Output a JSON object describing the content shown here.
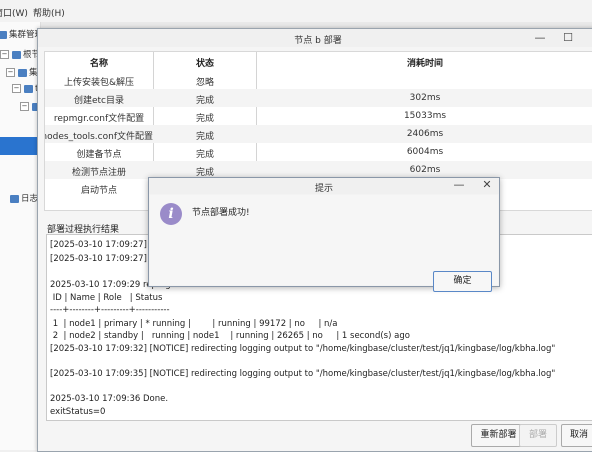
{
  "menubar": {
    "window_menu": "窗口(W)",
    "help_menu": "帮助(H)"
  },
  "tree": {
    "title": "集群管理",
    "items": [
      "根节点",
      "集群",
      "t",
      "",
      "日志"
    ]
  },
  "deploy_dialog": {
    "title": "节点 b 部署",
    "minimize": "—",
    "maximize": "☐",
    "columns": [
      "名称",
      "状态",
      "消耗时间"
    ],
    "rows": [
      {
        "name": "上传安装包&解压",
        "status": "忽略",
        "time": ""
      },
      {
        "name": "创建etc目录",
        "status": "完成",
        "time": "302ms"
      },
      {
        "name": "repmgr.conf文件配置",
        "status": "完成",
        "time": "15033ms"
      },
      {
        "name": "all_nodes_tools.conf文件配置",
        "status": "完成",
        "time": "2406ms"
      },
      {
        "name": "创建备节点",
        "status": "完成",
        "time": "6004ms"
      },
      {
        "name": "检测节点注册",
        "status": "完成",
        "time": "602ms"
      },
      {
        "name": "启动节点",
        "status": "",
        "time": ""
      }
    ],
    "log_label": "部署过程执行结果",
    "log_lines": [
      "[2025-03-10 17:09:27] [INFO]",
      "[2025-03-10 17:09:27] [NOTICE]",
      "",
      "2025-03-10 17:09:29 repmgr",
      " ID | Name | Role   | Status",
      "----+--------+---------+-----------",
      " 1  | node1 | primary | * running |        | running | 99172 | no     | n/a",
      " 2  | node2 | standby |   running | node1    | running | 26265 | no     | 1 second(s) ago",
      "[2025-03-10 17:09:32] [NOTICE] redirecting logging output to \"/home/kingbase/cluster/test/jq1/kingbase/log/kbha.log\"",
      "",
      "[2025-03-10 17:09:35] [NOTICE] redirecting logging output to \"/home/kingbase/cluster/test/jq1/kingbase/log/kbha.log\"",
      "",
      "2025-03-10 17:09:36 Done.",
      "",
      "",
      "exitStatus=0"
    ],
    "buttons": {
      "redeploy": "重新部署",
      "deploy": "部署",
      "cancel": "取消"
    }
  },
  "prompt_dialog": {
    "title": "提示",
    "minimize": "—",
    "close": "✕",
    "message": "节点部署成功!",
    "ok": "确定"
  }
}
